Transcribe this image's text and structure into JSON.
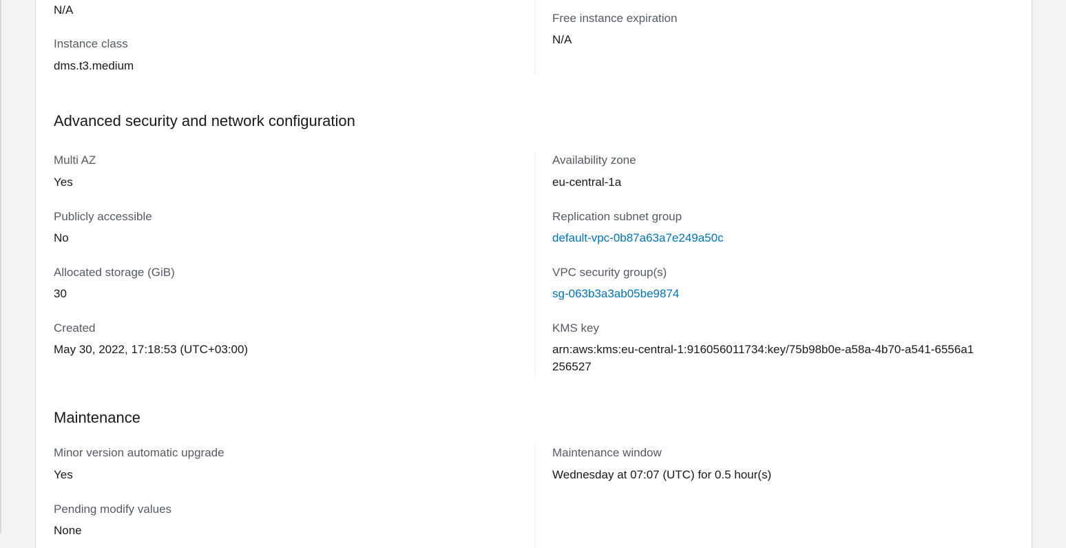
{
  "top": {
    "na_value": "N/A",
    "instance_class_label": "Instance class",
    "instance_class_value": "dms.t3.medium",
    "free_expiration_label": "Free instance expiration",
    "free_expiration_value": "N/A"
  },
  "advanced": {
    "title": "Advanced security and network configuration",
    "multi_az_label": "Multi AZ",
    "multi_az_value": "Yes",
    "public_label": "Publicly accessible",
    "public_value": "No",
    "storage_label": "Allocated storage (GiB)",
    "storage_value": "30",
    "created_label": "Created",
    "created_value": "May 30, 2022, 17:18:53 (UTC+03:00)",
    "az_label": "Availability zone",
    "az_value": "eu-central-1a",
    "subnet_label": "Replication subnet group",
    "subnet_value": "default-vpc-0b87a63a7e249a50c",
    "vpc_sg_label": "VPC security group(s)",
    "vpc_sg_value": "sg-063b3a3ab05be9874",
    "kms_label": "KMS key",
    "kms_value": "arn:aws:kms:eu-central-1:916056011734:key/75b98b0e-a58a-4b70-a541-6556a1256527"
  },
  "maintenance": {
    "title": "Maintenance",
    "minor_upgrade_label": "Minor version automatic upgrade",
    "minor_upgrade_value": "Yes",
    "pending_label": "Pending modify values",
    "pending_value": "None",
    "window_label": "Maintenance window",
    "window_value": "Wednesday at 07:07 (UTC) for 0.5 hour(s)"
  },
  "colors": {
    "link": "#0073bb",
    "label": "#545b64",
    "text": "#16191f",
    "background": "#f2f3f3"
  }
}
